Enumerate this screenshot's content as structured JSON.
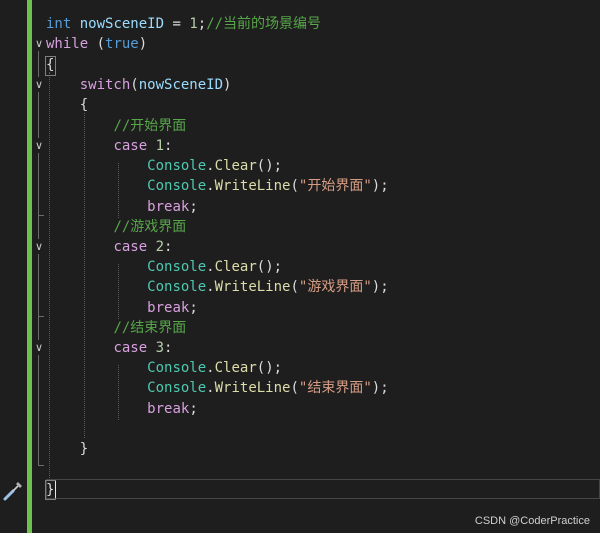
{
  "editor": {
    "watermark": "CSDN @CoderPractice",
    "lines": [
      [
        [
          "kw",
          "int"
        ],
        [
          "pun",
          " "
        ],
        [
          "var",
          "nowSceneID"
        ],
        [
          "pun",
          " = "
        ],
        [
          "num",
          "1"
        ],
        [
          "pun",
          ";"
        ],
        [
          "cmt",
          "//当前的场景编号"
        ]
      ],
      [
        [
          "ctl",
          "while"
        ],
        [
          "pun",
          " ("
        ],
        [
          "kw",
          "true"
        ],
        [
          "pun",
          ")"
        ]
      ],
      [
        [
          "pun",
          "{"
        ]
      ],
      [
        [
          "pun",
          "    "
        ],
        [
          "ctl",
          "switch"
        ],
        [
          "pun",
          "("
        ],
        [
          "var",
          "nowSceneID"
        ],
        [
          "pun",
          ")"
        ]
      ],
      [
        [
          "pun",
          "    {"
        ]
      ],
      [
        [
          "pun",
          "        "
        ],
        [
          "cmt",
          "//开始界面"
        ]
      ],
      [
        [
          "pun",
          "        "
        ],
        [
          "ctl",
          "case"
        ],
        [
          "pun",
          " "
        ],
        [
          "num",
          "1"
        ],
        [
          "pun",
          ":"
        ]
      ],
      [
        [
          "pun",
          "            "
        ],
        [
          "cls",
          "Console"
        ],
        [
          "pun",
          "."
        ],
        [
          "meth",
          "Clear"
        ],
        [
          "pun",
          "();"
        ]
      ],
      [
        [
          "pun",
          "            "
        ],
        [
          "cls",
          "Console"
        ],
        [
          "pun",
          "."
        ],
        [
          "meth",
          "WriteLine"
        ],
        [
          "pun",
          "("
        ],
        [
          "str",
          "\"开始界面\""
        ],
        [
          "pun",
          ");"
        ]
      ],
      [
        [
          "pun",
          "            "
        ],
        [
          "ctl",
          "break"
        ],
        [
          "pun",
          ";"
        ]
      ],
      [
        [
          "pun",
          "        "
        ],
        [
          "cmt",
          "//游戏界面"
        ]
      ],
      [
        [
          "pun",
          "        "
        ],
        [
          "ctl",
          "case"
        ],
        [
          "pun",
          " "
        ],
        [
          "num",
          "2"
        ],
        [
          "pun",
          ":"
        ]
      ],
      [
        [
          "pun",
          "            "
        ],
        [
          "cls",
          "Console"
        ],
        [
          "pun",
          "."
        ],
        [
          "meth",
          "Clear"
        ],
        [
          "pun",
          "();"
        ]
      ],
      [
        [
          "pun",
          "            "
        ],
        [
          "cls",
          "Console"
        ],
        [
          "pun",
          "."
        ],
        [
          "meth",
          "WriteLine"
        ],
        [
          "pun",
          "("
        ],
        [
          "str",
          "\"游戏界面\""
        ],
        [
          "pun",
          ");"
        ]
      ],
      [
        [
          "pun",
          "            "
        ],
        [
          "ctl",
          "break"
        ],
        [
          "pun",
          ";"
        ]
      ],
      [
        [
          "pun",
          "        "
        ],
        [
          "cmt",
          "//结束界面"
        ]
      ],
      [
        [
          "pun",
          "        "
        ],
        [
          "ctl",
          "case"
        ],
        [
          "pun",
          " "
        ],
        [
          "num",
          "3"
        ],
        [
          "pun",
          ":"
        ]
      ],
      [
        [
          "pun",
          "            "
        ],
        [
          "cls",
          "Console"
        ],
        [
          "pun",
          "."
        ],
        [
          "meth",
          "Clear"
        ],
        [
          "pun",
          "();"
        ]
      ],
      [
        [
          "pun",
          "            "
        ],
        [
          "cls",
          "Console"
        ],
        [
          "pun",
          "."
        ],
        [
          "meth",
          "WriteLine"
        ],
        [
          "pun",
          "("
        ],
        [
          "str",
          "\"结束界面\""
        ],
        [
          "pun",
          ");"
        ]
      ],
      [
        [
          "pun",
          "            "
        ],
        [
          "ctl",
          "break"
        ],
        [
          "pun",
          ";"
        ]
      ],
      [],
      [
        [
          "pun",
          "    }"
        ]
      ],
      [],
      [
        [
          "pun",
          "}"
        ]
      ]
    ],
    "fold_glyph": "∨"
  },
  "colors": {
    "background": "#1e1e1e",
    "change_bar": "#6cc24a",
    "keyword": "#569cd6",
    "control": "#d8a0df",
    "comment": "#57a64a",
    "number": "#b5cea8",
    "class": "#4ec9b0",
    "method": "#dcdcaa",
    "string": "#d69d85",
    "variable": "#9cdcfe"
  },
  "icons": {
    "quick_actions": "screwdriver-icon",
    "fold": "chevron-down-icon"
  }
}
